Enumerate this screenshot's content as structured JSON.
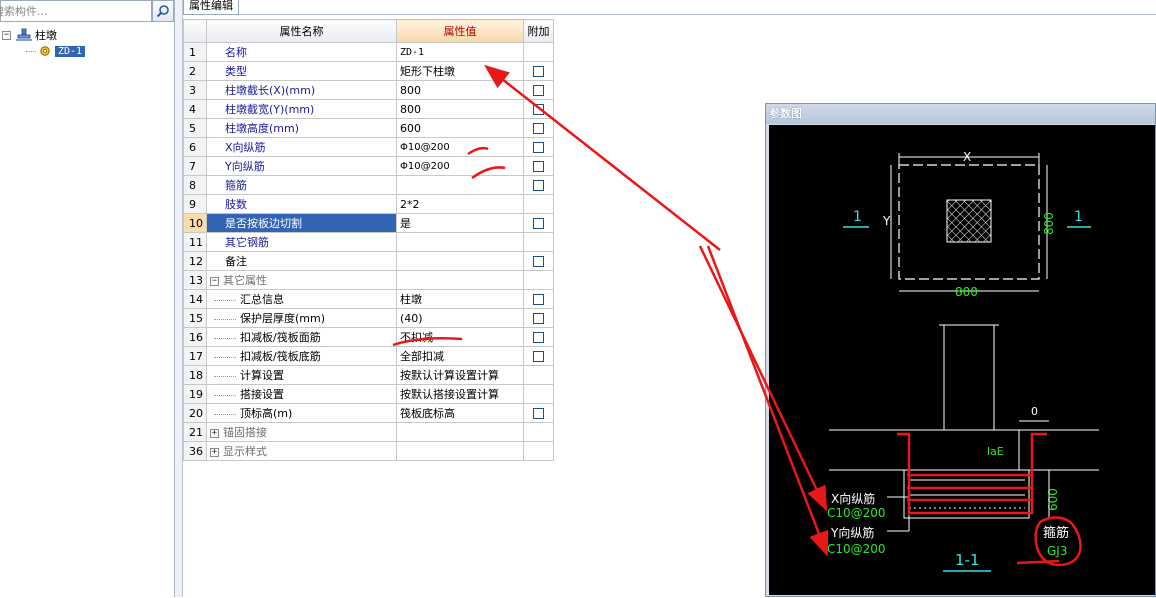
{
  "search": {
    "placeholder": "搜索构件..."
  },
  "tree": {
    "root_label": "柱墩",
    "child_label": "ZD-1"
  },
  "tab": {
    "label": "属性编辑"
  },
  "grid": {
    "headers": {
      "name": "属性名称",
      "value": "属性值",
      "extra": "附加"
    },
    "rows": [
      {
        "num": "1",
        "name": "名称",
        "value": "ZD-1",
        "checkbox": false
      },
      {
        "num": "2",
        "name": "类型",
        "value": "矩形下柱墩",
        "checkbox": true
      },
      {
        "num": "3",
        "name": "柱墩截长(X)(mm)",
        "value": "800",
        "checkbox": true
      },
      {
        "num": "4",
        "name": "柱墩截宽(Y)(mm)",
        "value": "800",
        "checkbox": true
      },
      {
        "num": "5",
        "name": "柱墩高度(mm)",
        "value": "600",
        "checkbox": true
      },
      {
        "num": "6",
        "name": "X向纵筋",
        "value": "Φ10@200",
        "checkbox": true
      },
      {
        "num": "7",
        "name": "Y向纵筋",
        "value": "Φ10@200",
        "checkbox": true
      },
      {
        "num": "8",
        "name": "箍筋",
        "value": "",
        "checkbox": true
      },
      {
        "num": "9",
        "name": "肢数",
        "value": "2*2",
        "checkbox": false
      },
      {
        "num": "10",
        "name": "是否按板边切割",
        "value": "是",
        "checkbox": true
      },
      {
        "num": "11",
        "name": "其它钢筋",
        "value": "",
        "checkbox": false
      },
      {
        "num": "12",
        "name": "备注",
        "value": "",
        "checkbox": true
      },
      {
        "num": "13",
        "name": "其它属性",
        "value": "",
        "checkbox": false
      },
      {
        "num": "14",
        "name": "汇总信息",
        "value": "柱墩",
        "checkbox": true
      },
      {
        "num": "15",
        "name": "保护层厚度(mm)",
        "value": "(40)",
        "checkbox": true
      },
      {
        "num": "16",
        "name": "扣减板/筏板面筋",
        "value": "不扣减",
        "checkbox": true
      },
      {
        "num": "17",
        "name": "扣减板/筏板底筋",
        "value": "全部扣减",
        "checkbox": true
      },
      {
        "num": "18",
        "name": "计算设置",
        "value": "按默认计算设置计算",
        "checkbox": false
      },
      {
        "num": "19",
        "name": "搭接设置",
        "value": "按默认搭接设置计算",
        "checkbox": false
      },
      {
        "num": "20",
        "name": "顶标高(m)",
        "value": "筏板底标高",
        "checkbox": true
      },
      {
        "num": "21",
        "name": "锚固搭接",
        "value": "",
        "checkbox": false
      },
      {
        "num": "36",
        "name": "显示样式",
        "value": "",
        "checkbox": false
      }
    ]
  },
  "param_panel": {
    "title": "参数图",
    "labels": {
      "x": "X",
      "y": "Y",
      "section_left": "1",
      "section_right": "1",
      "dim_800_right": "800",
      "dim_800_bottom": "800",
      "dim_0": "0",
      "lae": "laE",
      "dim_600": "600",
      "x_rebar": "X向纵筋",
      "x_rebar_val": "C10@200",
      "y_rebar": "Y向纵筋",
      "y_rebar_val": "C10@200",
      "stirrup": "箍筋",
      "stirrup_val": "GJ3",
      "section_title": "1-1"
    }
  },
  "colors": {
    "annotation_red": "#e81818",
    "cad_green": "#2ee62e",
    "cad_cyan": "#35e0e0",
    "selection_blue": "#3264b4"
  }
}
